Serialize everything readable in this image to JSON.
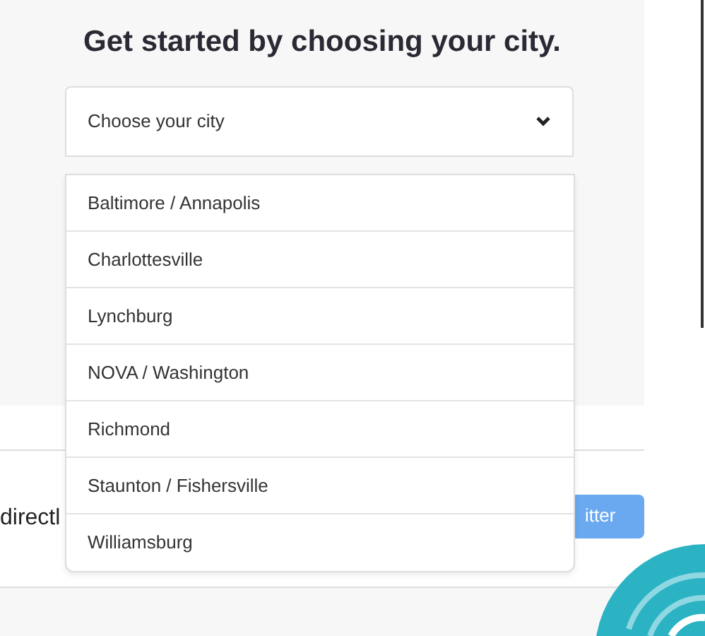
{
  "heading": "Get started by choosing your city.",
  "city_select": {
    "placeholder": "Choose your city",
    "expanded": true
  },
  "cities": [
    {
      "label": "Baltimore / Annapolis",
      "selected": false
    },
    {
      "label": "Charlottesville",
      "selected": false
    },
    {
      "label": "Lynchburg",
      "selected": false
    },
    {
      "label": "NOVA / Washington",
      "selected": false
    },
    {
      "label": "Richmond",
      "selected": false
    },
    {
      "label": "Staunton / Fishersville",
      "selected": false
    },
    {
      "label": "Williamsburg",
      "selected": false
    }
  ],
  "partial_text": "directl",
  "partial_button": "itter"
}
